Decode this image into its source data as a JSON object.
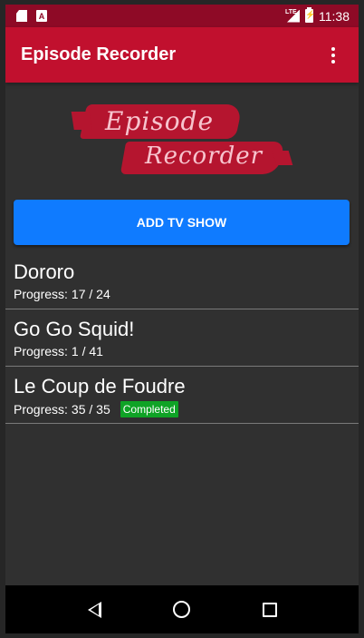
{
  "status_bar": {
    "icons_left": [
      "sd-card-icon",
      "a-notification-icon"
    ],
    "network": "LTE",
    "time": "11:38"
  },
  "app_bar": {
    "title": "Episode Recorder",
    "menu_icon": "overflow-menu-icon"
  },
  "logo": {
    "line1": "Episode",
    "line2": "Recorder",
    "color": "#b5152f"
  },
  "add_button": {
    "label": "ADD TV SHOW",
    "color": "#0f7bff"
  },
  "shows": [
    {
      "title": "Dororo",
      "progress_label": "Progress:",
      "progress": "17 / 24",
      "badge": ""
    },
    {
      "title": "Go Go Squid!",
      "progress_label": "Progress:",
      "progress": "1 / 41",
      "badge": ""
    },
    {
      "title": "Le Coup de Foudre",
      "progress_label": "Progress:",
      "progress": "35 / 35",
      "badge": "Completed"
    }
  ],
  "colors": {
    "app_bar": "#c1102e",
    "status_bar": "#8e0a26",
    "background": "#303030",
    "completed_badge": "#0fa326"
  },
  "nav_bar": {
    "icons": [
      "back-icon",
      "home-icon",
      "recents-icon"
    ]
  }
}
